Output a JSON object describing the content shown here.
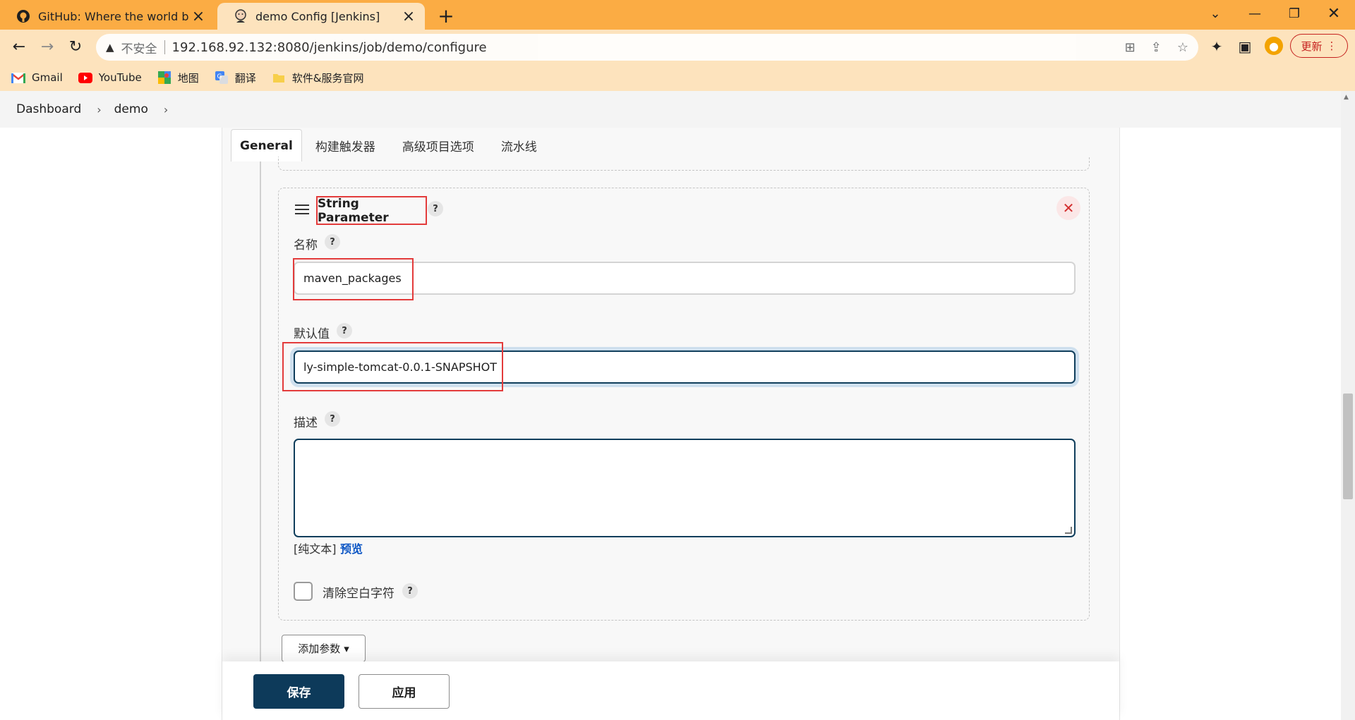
{
  "browser": {
    "tabs": [
      {
        "title": "GitHub: Where the world build",
        "icon": "github-icon"
      },
      {
        "title": "demo Config [Jenkins]",
        "icon": "jenkins-icon"
      }
    ],
    "address": {
      "security_label": "不安全",
      "url": "192.168.92.132:8080/jenkins/job/demo/configure"
    },
    "update_label": "更新",
    "bookmarks": [
      {
        "label": "Gmail",
        "icon": "gmail-icon",
        "color": "#ea4335"
      },
      {
        "label": "YouTube",
        "icon": "youtube-icon",
        "color": "#ff0000"
      },
      {
        "label": "地图",
        "icon": "maps-icon",
        "color": "#34a853"
      },
      {
        "label": "翻译",
        "icon": "translate-icon",
        "color": "#4285f4"
      },
      {
        "label": "软件&服务官网",
        "icon": "folder-icon",
        "color": "#f7cf4a"
      }
    ],
    "colors": {
      "tabstrip": "#fbac44",
      "toolbar": "#fde3bd"
    }
  },
  "breadcrumb": {
    "items": [
      "Dashboard",
      "demo"
    ]
  },
  "config_tabs": [
    "General",
    "构建触发器",
    "高级项目选项",
    "流水线"
  ],
  "parameter": {
    "type_title": "String Parameter",
    "name_label": "名称",
    "name_value": "maven_packages",
    "default_label": "默认值",
    "default_value": "ly-simple-tomcat-0.0.1-SNAPSHOT",
    "description_label": "描述",
    "description_value": "",
    "plain_text_label": "[纯文本]",
    "preview_label": "预览",
    "trim_label": "清除空白字符",
    "help_glyph": "?"
  },
  "add_param_label": "添加参数",
  "actions": {
    "save_label": "保存",
    "apply_label": "应用"
  },
  "colors": {
    "save_button": "#0d3a5a",
    "highlight_box": "#e33b3b",
    "link": "#0b55c4"
  }
}
